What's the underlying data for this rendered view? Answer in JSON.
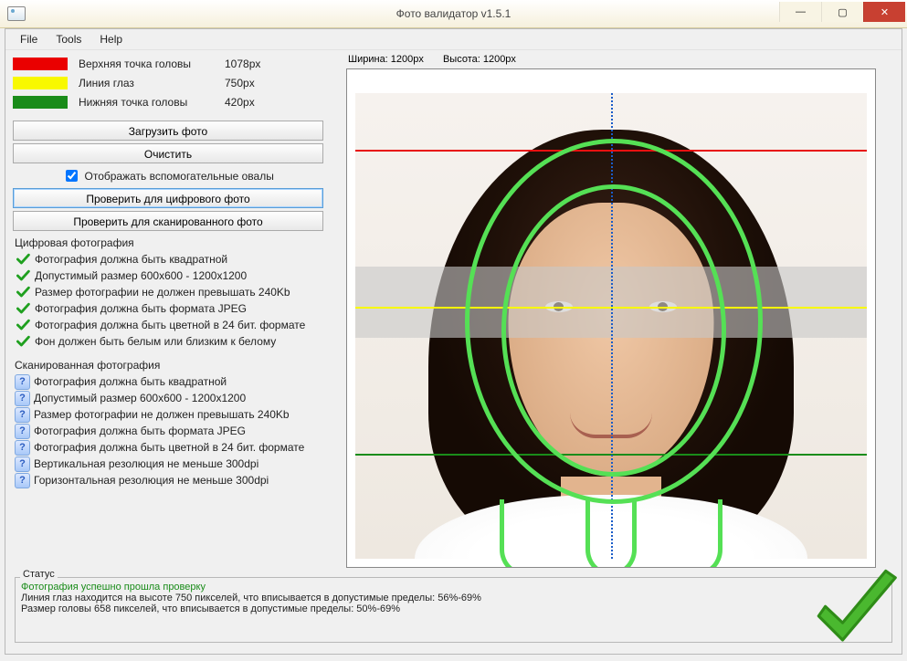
{
  "window": {
    "title": "Фото валидатор v1.5.1"
  },
  "menu": {
    "file": "File",
    "tools": "Tools",
    "help": "Help"
  },
  "legend": {
    "top": {
      "label": "Верхняя точка головы",
      "value": "1078px"
    },
    "eyes": {
      "label": "Линия глаз",
      "value": "750px"
    },
    "bottom": {
      "label": "Нижняя точка головы",
      "value": "420px"
    }
  },
  "buttons": {
    "load": "Загрузить фото",
    "clear": "Очистить",
    "ovals_checkbox": "Отображать вспомогательные овалы",
    "check_digital": "Проверить для цифрового фото",
    "check_scanned": "Проверить для сканированного фото"
  },
  "digital": {
    "title": "Цифровая фотография",
    "items": [
      "Фотография должна быть квадратной",
      "Допустимый размер 600x600 - 1200x1200",
      "Размер фотографии не должен превышать 240Kb",
      "Фотография должна быть формата JPEG",
      "Фотография должна быть цветной в 24 бит. формате",
      "Фон должен быть белым или близким к белому"
    ]
  },
  "scanned": {
    "title": "Сканированная фотография",
    "items": [
      "Фотография должна быть квадратной",
      "Допустимый размер 600x600 - 1200x1200",
      "Размер фотографии не должен превышать 240Kb",
      "Фотография должна быть формата JPEG",
      "Фотография должна быть цветной в 24 бит. формате",
      "Вертикальная резолюция не меньше 300dpi",
      "Горизонтальная резолюция не меньше 300dpi"
    ]
  },
  "preview": {
    "width_label": "Ширина: 1200px",
    "height_label": "Высота: 1200px"
  },
  "status": {
    "label": "Статус",
    "line1": "Фотография успешно прошла проверку",
    "line2": "Линия глаз находится на высоте 750 пикселей, что вписывается в допустимые пределы: 56%-69%",
    "line3": "Размер головы 658 пикселей, что вписывается в допустимые пределы: 50%-69%"
  }
}
